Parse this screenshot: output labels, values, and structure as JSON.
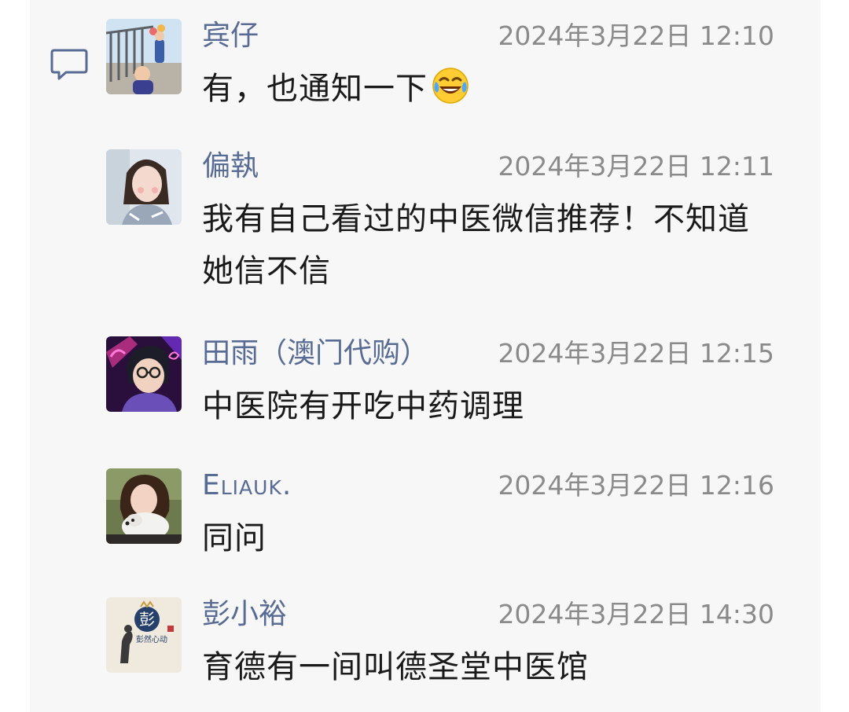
{
  "comments": [
    {
      "name": "宾仔",
      "time": "2024年3月22日 12:10",
      "text": "有，也通知一下",
      "emoji": "tears-of-joy-emoji"
    },
    {
      "name": "偏執",
      "time": "2024年3月22日 12:11",
      "text": "我有自己看过的中医微信推荐！不知道她信不信"
    },
    {
      "name": "田雨（澳门代购）",
      "time": "2024年3月22日 12:15",
      "text": "中医院有开吃中药调理"
    },
    {
      "name": "Eliauk.",
      "time": "2024年3月22日 12:16",
      "text": "同问"
    },
    {
      "name": "彭小裕",
      "time": "2024年3月22日 14:30",
      "text": "育德有一间叫德圣堂中医馆",
      "avatar_logo_text": "彭",
      "avatar_logo_subtext": "彭然心动"
    }
  ],
  "icons": {
    "comment": "comment-bubble-icon"
  },
  "colors": {
    "name": "#576b95",
    "time": "#8a8a8a",
    "text": "#1a1a1a",
    "panel_bg": "#f7f7f7"
  }
}
